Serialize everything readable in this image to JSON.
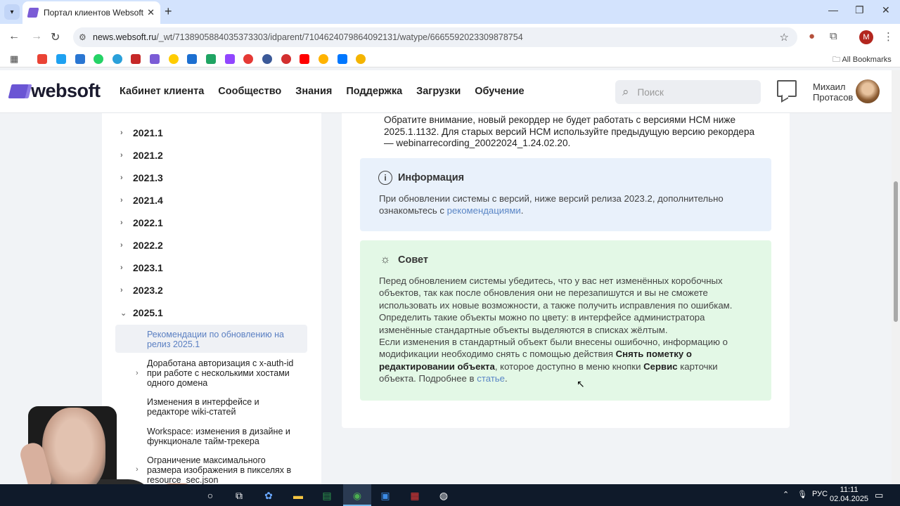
{
  "browser": {
    "tab_title": "Портал клиентов Websoft",
    "url_host": "news.websoft.ru",
    "url_path": "/_wt/7138905884035373303/idparent/7104624079864092131/watype/6665592023309878754",
    "profile_initial": "M",
    "all_bookmarks": "All Bookmarks"
  },
  "site": {
    "logo_text": "websoft",
    "nav": [
      "Кабинет клиента",
      "Сообщество",
      "Знания",
      "Поддержка",
      "Загрузки",
      "Обучение"
    ],
    "search_placeholder": "Поиск",
    "user_first": "Михаил",
    "user_last": "Протасов"
  },
  "sidebar": {
    "versions": [
      "2021.1",
      "2021.2",
      "2021.3",
      "2021.4",
      "2022.1",
      "2022.2",
      "2023.1",
      "2023.2",
      "2025.1"
    ],
    "sub_items": [
      {
        "line1": "Рекомендации по обновлению на",
        "line2": "релиз 2025.1",
        "line3": ""
      },
      {
        "line1": "Доработана авторизация с x-auth-id",
        "line2": "при работе с несколькими хостами",
        "line3": "одного домена"
      },
      {
        "line1": "Изменения в интерфейсе и",
        "line2": "редакторе wiki-статей",
        "line3": ""
      },
      {
        "line1": "Workspace: изменения в дизайне и",
        "line2": "функционале тайм-трекера",
        "line3": ""
      },
      {
        "line1": "Ограничение максимального",
        "line2": "размера изображения в пикселях в",
        "line3": "resource_sec.json"
      }
    ]
  },
  "content": {
    "intro_1": "Обратите внимание, новый рекордер не будет работать с версиями НСМ ниже",
    "intro_2": "2025.1.1132. Для старых версий НСМ используйте предыдущую версию рекордера",
    "intro_3": "— webinarrecording_20022024_1.24.02.20.",
    "info": {
      "title": "Информация",
      "text_1": "При обновлении системы с версий, ниже версий релиза 2023.2, дополнительно",
      "text_2": "ознакомьтесь с ",
      "link": "рекомендациями",
      "text_2_end": "."
    },
    "tip": {
      "title": "Совет",
      "l1": "Перед обновлением системы убедитесь, что у вас нет изменённых коробочных",
      "l2": "объектов, так как после обновления они не перезапишутся и вы не сможете",
      "l3": "использовать их новые возможности, а также получить исправления по ошибкам.",
      "l4": "Определить такие объекты можно по цвету: в интерфейсе администратора",
      "l5": "изменённые стандартные объекты выделяются в списках жёлтым.",
      "l6": "Если изменения в стандартный объект были внесены ошибочно, информацию о",
      "l7a": "модификации необходимо снять с помощью действия ",
      "l7b": "Снять пометку о",
      "l8a": "редактировании объекта",
      "l8b": ", которое доступно в меню кнопки ",
      "l8c": "Сервис",
      "l8d": " карточки",
      "l9a": "объекта. Подробнее в ",
      "l9link": "статье",
      "l9end": "."
    }
  },
  "taskbar": {
    "lang": "РУС",
    "time": "11:11",
    "date": "02.04.2025"
  }
}
